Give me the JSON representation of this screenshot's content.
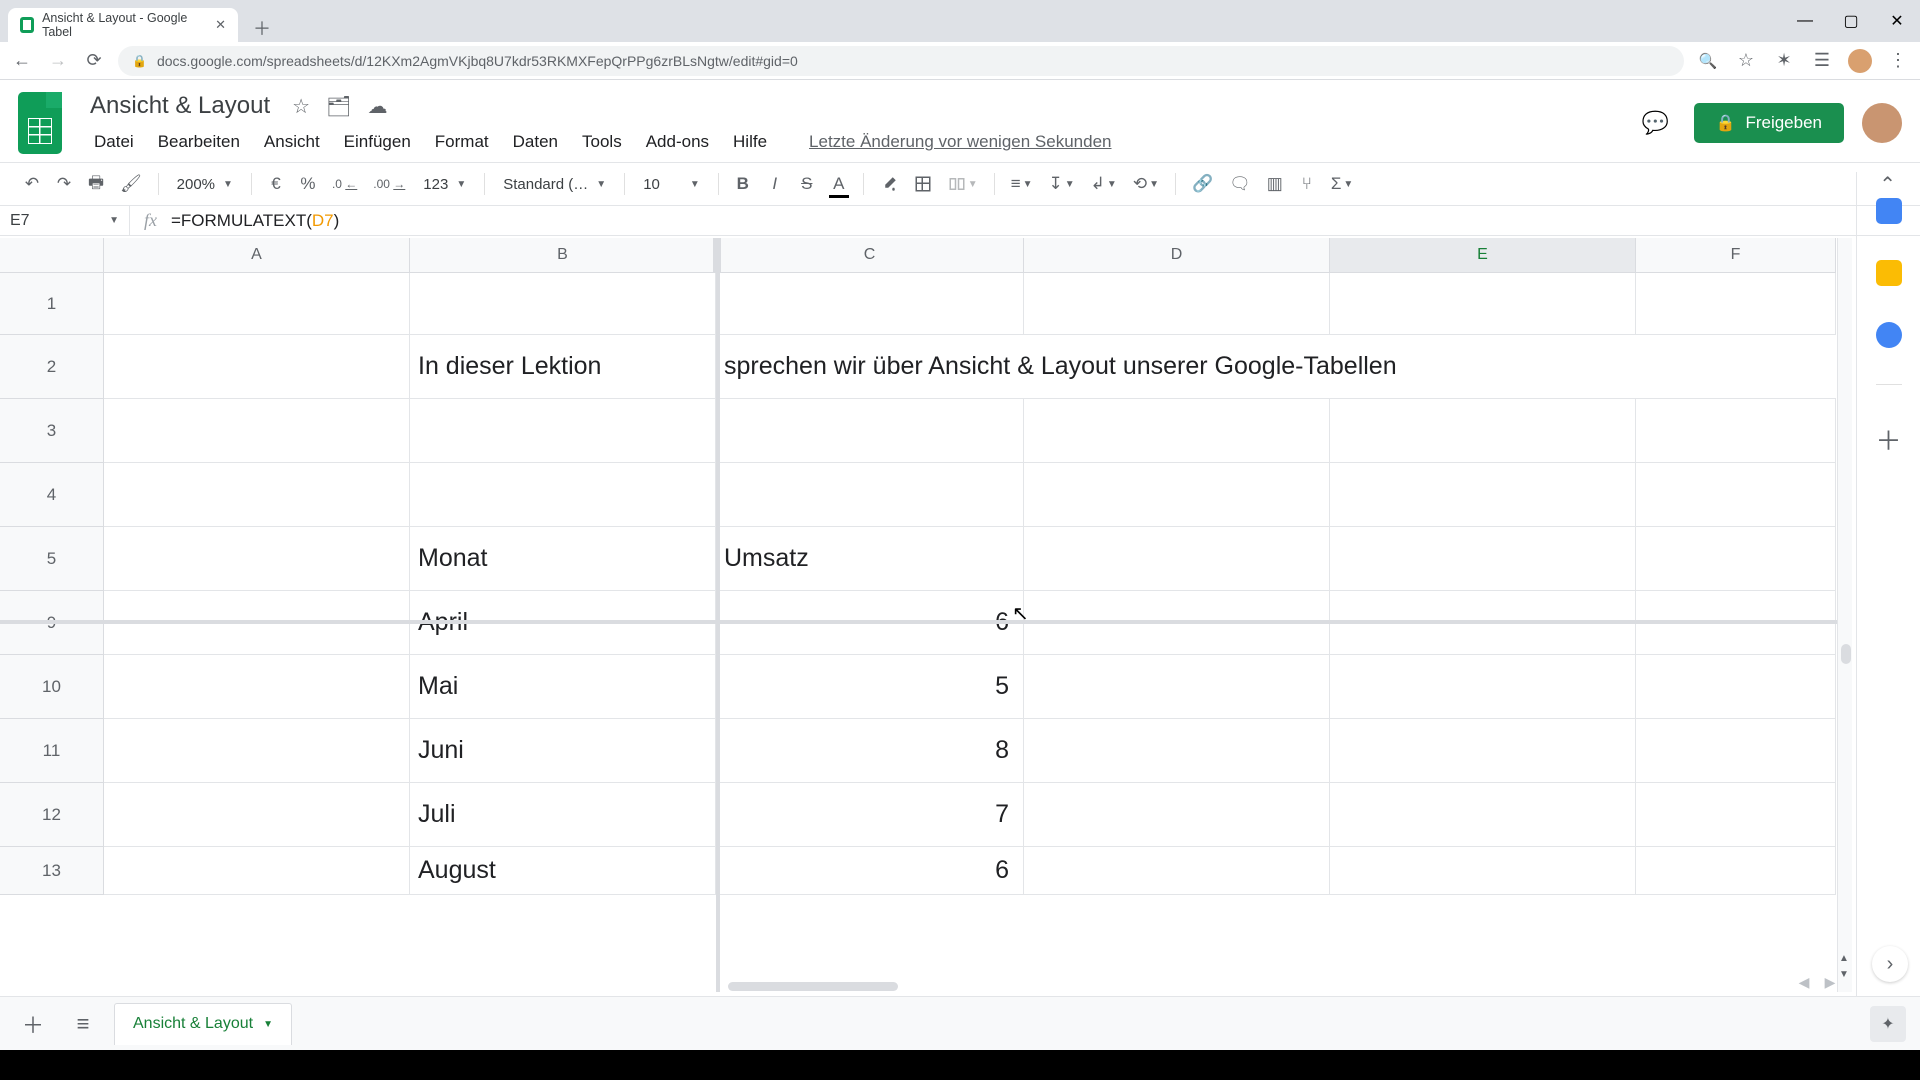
{
  "browser": {
    "tab_title": "Ansicht & Layout - Google Tabel",
    "url": "docs.google.com/spreadsheets/d/12KXm2AgmVKjbq8U7kdr53RKMXFepQrPPg6zrBLsNgtw/edit#gid=0"
  },
  "doc": {
    "title": "Ansicht & Layout",
    "last_edit": "Letzte Änderung vor wenigen Sekunden",
    "share_label": "Freigeben"
  },
  "menu": {
    "file": "Datei",
    "edit": "Bearbeiten",
    "view": "Ansicht",
    "insert": "Einfügen",
    "format": "Format",
    "data": "Daten",
    "tools": "Tools",
    "addons": "Add-ons",
    "help": "Hilfe"
  },
  "toolbar": {
    "zoom": "200%",
    "currency": "€",
    "percent": "%",
    "dec_minus": ".0",
    "dec_plus": ".00",
    "more_fmt": "123",
    "font": "Standard (…",
    "font_size": "10"
  },
  "fx": {
    "name_box": "E7",
    "formula_pre": "=FORMULATEXT(",
    "formula_ref": "D7",
    "formula_post": ")"
  },
  "columns": {
    "A": "A",
    "B": "B",
    "C": "C",
    "D": "D",
    "E": "E",
    "F": "F"
  },
  "row_numbers": [
    "1",
    "2",
    "3",
    "4",
    "5",
    "9",
    "10",
    "11",
    "12",
    "13"
  ],
  "cells": {
    "B2": "In dieser Lektion",
    "C2": "sprechen wir über Ansicht & Layout unserer Google-Tabellen",
    "B5": "Monat",
    "C5": "Umsatz",
    "B9": "April",
    "C9": "6",
    "B10": "Mai",
    "C10": "5",
    "B11": "Juni",
    "C11": "8",
    "B12": "Juli",
    "C12": "7",
    "B13": "August",
    "C13": "6"
  },
  "sheet_tab": {
    "name": "Ansicht & Layout"
  }
}
